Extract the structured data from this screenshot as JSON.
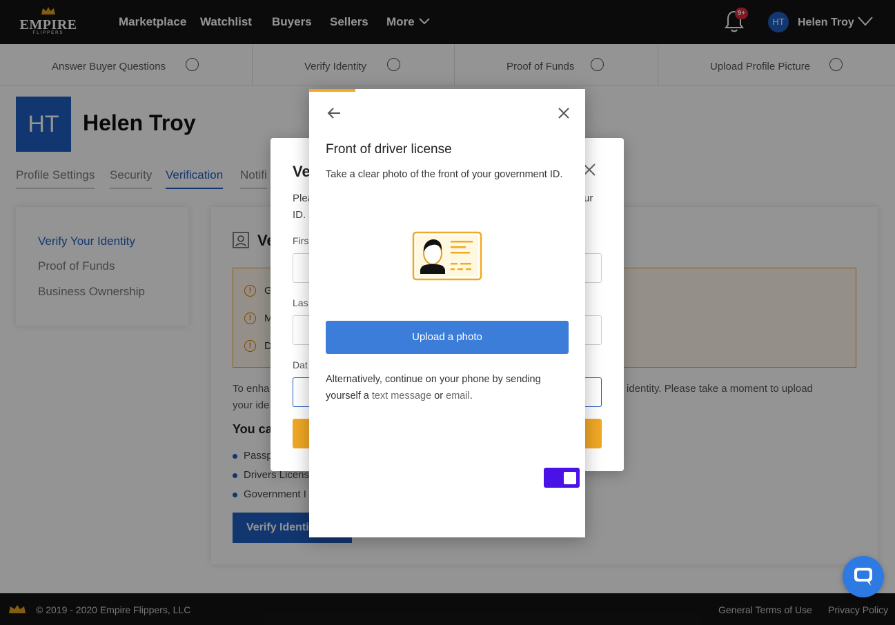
{
  "nav": {
    "logo_text": "EMPIRE",
    "logo_sub": "FLIPPERS",
    "links": [
      "Marketplace",
      "Watchlist",
      "Buyers",
      "Sellers",
      "More"
    ],
    "notif_badge": "9+",
    "avatar_initials": "HT",
    "user_name": "Helen Troy"
  },
  "steps": [
    "Answer Buyer Questions",
    "Verify Identity",
    "Proof of Funds",
    "Upload Profile Picture"
  ],
  "profile": {
    "initials": "HT",
    "name": "Helen Troy",
    "tabs": [
      "Profile Settings",
      "Security",
      "Verification",
      "Notifi"
    ]
  },
  "sidebar": {
    "items": [
      "Verify Your Identity",
      "Proof of Funds",
      "Business Ownership"
    ]
  },
  "main": {
    "title": "Ve",
    "warnings": [
      "G",
      "M",
      "D"
    ],
    "text_line1_left": "To enha",
    "text_line1_right": "identity. Please take a moment to upload",
    "text_line2": "your ide",
    "subheading": "You ca",
    "bullets": [
      "Passp",
      "Drivers Licens",
      "Government I"
    ],
    "verify_button": "Verify Identi"
  },
  "mid_dialog": {
    "title": "Ve",
    "desc_line1": "Plea",
    "desc_line1_right": "ur",
    "desc_line2": "ID.",
    "label_first": "Firs",
    "label_last": "Las",
    "last_value": "",
    "label_date": "Dat"
  },
  "capture": {
    "title": "Front of driver license",
    "description": "Take a clear photo of the front of your government ID.",
    "upload_label": "Upload a photo",
    "alt_prefix": "Alternatively, continue on your phone by sending yourself a",
    "alt_link1": "text message",
    "alt_or": "or",
    "alt_link2": "email",
    "alt_suffix": "."
  },
  "footer": {
    "copyright": "© 2019 - 2020 Empire Flippers, LLC",
    "terms": "General Terms of Use",
    "privacy": "Privacy Policy"
  },
  "colors": {
    "brand_blue": "#1f5dbf",
    "upload_blue": "#3c7dd9",
    "accent_orange": "#f0a825",
    "toggle_purple": "#4a12e6",
    "nav_bg": "#141414"
  }
}
